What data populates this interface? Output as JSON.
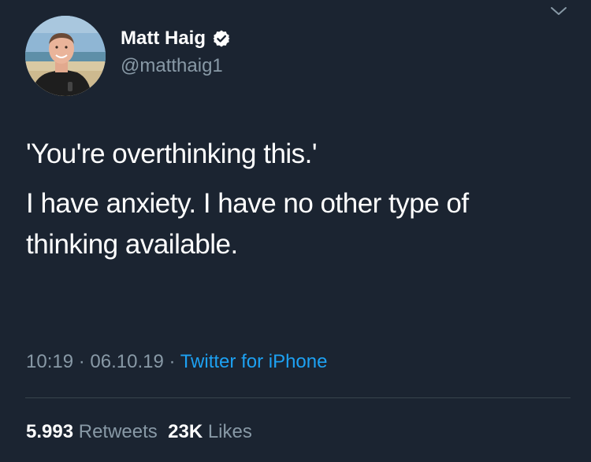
{
  "colors": {
    "background": "#1b2431",
    "primary_text": "#ffffff",
    "secondary_text": "#8899a6",
    "link": "#1da1f2",
    "divider": "#38444d"
  },
  "author": {
    "name": "Matt Haig",
    "handle": "@matthaig1",
    "verified": true,
    "verified_icon": "verified-badge-icon"
  },
  "tweet": {
    "paragraph_1": "'You're overthinking this.'",
    "paragraph_2_line_1": "I have anxiety. I have no other type of",
    "paragraph_2_line_2": "thinking available."
  },
  "meta": {
    "time": "10:19",
    "separator_1": " · ",
    "date": "06.10.19",
    "separator_2": " · ",
    "source": "Twitter for iPhone"
  },
  "stats": {
    "retweets_count": "5.993",
    "retweets_label": "Retweets",
    "likes_count": "23K",
    "likes_label": "Likes"
  },
  "icons": {
    "menu": "chevron-down-icon",
    "avatar": "avatar"
  }
}
